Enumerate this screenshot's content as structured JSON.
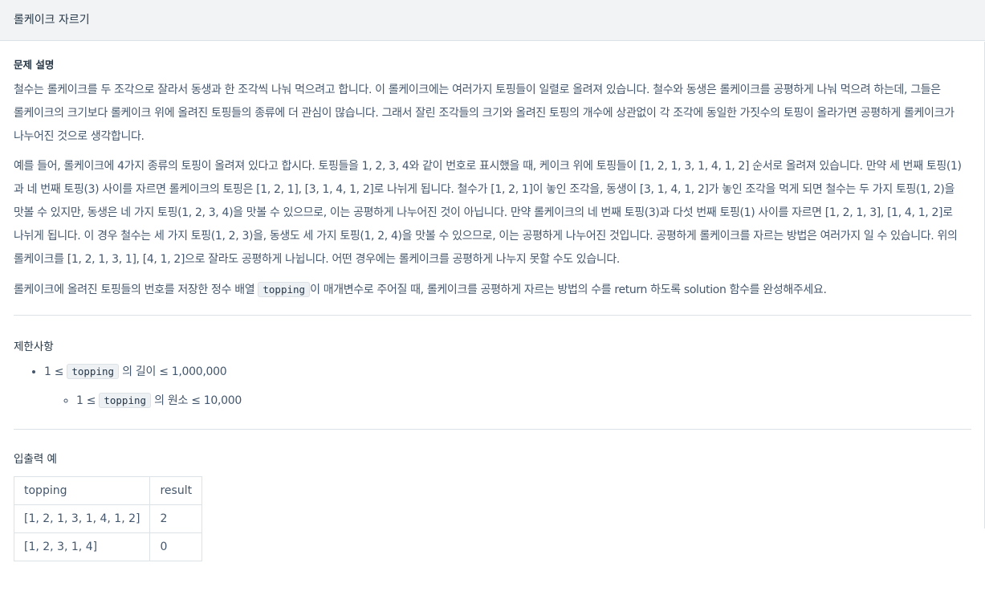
{
  "header": {
    "title": "롤케이크 자르기"
  },
  "description": {
    "heading": "문제 설명",
    "paragraph1": "철수는 롤케이크를 두 조각으로 잘라서 동생과 한 조각씩 나눠 먹으려고 합니다. 이 롤케이크에는 여러가지 토핑들이 일렬로 올려져 있습니다. 철수와 동생은 롤케이크를 공평하게 나눠 먹으려 하는데, 그들은 롤케이크의 크기보다 롤케이크 위에 올려진 토핑들의 종류에 더 관심이 많습니다. 그래서 잘린 조각들의 크기와 올려진 토핑의 개수에 상관없이 각 조각에 동일한 가짓수의 토핑이 올라가면 공평하게 롤케이크가 나누어진 것으로 생각합니다.",
    "paragraph2": "예를 들어, 롤케이크에 4가지 종류의 토핑이 올려져 있다고 합시다. 토핑들을 1, 2, 3, 4와 같이 번호로 표시했을 때, 케이크 위에 토핑들이 [1, 2, 1, 3, 1, 4, 1, 2] 순서로 올려져 있습니다. 만약 세 번째 토핑(1)과 네 번째 토핑(3) 사이를 자르면 롤케이크의 토핑은 [1, 2, 1], [3, 1, 4, 1, 2]로 나뉘게 됩니다. 철수가 [1, 2, 1]이 놓인 조각을, 동생이 [3, 1, 4, 1, 2]가 놓인 조각을 먹게 되면 철수는 두 가지 토핑(1, 2)을 맛볼 수 있지만, 동생은 네 가지 토핑(1, 2, 3, 4)을 맛볼 수 있으므로, 이는 공평하게 나누어진 것이 아닙니다. 만약 롤케이크의 네 번째 토핑(3)과 다섯 번째 토핑(1) 사이를 자르면 [1, 2, 1, 3], [1, 4, 1, 2]로 나뉘게 됩니다. 이 경우 철수는 세 가지 토핑(1, 2, 3)을, 동생도 세 가지 토핑(1, 2, 4)을 맛볼 수 있으므로, 이는 공평하게 나누어진 것입니다. 공평하게 롤케이크를 자르는 방법은 여러가지 일 수 있습니다. 위의 롤케이크를 [1, 2, 1, 3, 1], [4, 1, 2]으로 잘라도 공평하게 나뉩니다. 어떤 경우에는 롤케이크를 공평하게 나누지 못할 수도 있습니다.",
    "paragraph3_before": "롤케이크에 올려진 토핑들의 번호를 저장한 정수 배열 ",
    "paragraph3_code": "topping",
    "paragraph3_after": "이 매개변수로 주어질 때, 롤케이크를 공평하게 자르는 방법의 수를 return 하도록 solution 함수를 완성해주세요."
  },
  "constraints": {
    "heading": "제한사항",
    "item1_before": "1 ≤ ",
    "item1_code": "topping",
    "item1_after": " 의 길이 ≤ 1,000,000",
    "item2_before": "1 ≤ ",
    "item2_code": "topping",
    "item2_after": " 의 원소 ≤ 10,000"
  },
  "examples": {
    "heading": "입출력 예",
    "columns": [
      "topping",
      "result"
    ],
    "rows": [
      [
        "[1, 2, 1, 3, 1, 4, 1, 2]",
        "2"
      ],
      [
        "[1, 2, 3, 1, 4]",
        "0"
      ]
    ]
  }
}
